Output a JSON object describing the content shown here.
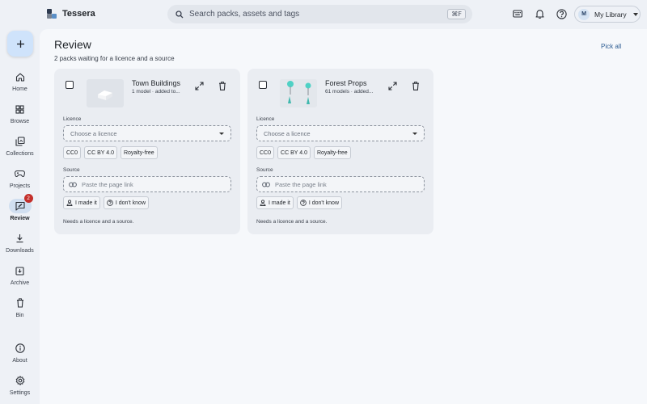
{
  "app": {
    "name": "Tessera"
  },
  "search": {
    "placeholder": "Search packs, assets and tags",
    "shortcut": "⌘F"
  },
  "topbar": {
    "icons": [
      "keyboard-icon",
      "bell-icon",
      "help-icon"
    ],
    "library": {
      "avatar": "M",
      "label": "My Library"
    }
  },
  "sidebar": {
    "new_button_icon": "plus-icon",
    "items": [
      {
        "label": "Home",
        "icon": "home-icon"
      },
      {
        "label": "Browse",
        "icon": "grid-icon"
      },
      {
        "label": "Collections",
        "icon": "collections-icon"
      },
      {
        "label": "Projects",
        "icon": "gamepad-icon"
      },
      {
        "label": "Review",
        "icon": "review-icon",
        "badge": "2",
        "active": true
      },
      {
        "label": "Downloads",
        "icon": "download-icon"
      },
      {
        "label": "Archive",
        "icon": "archive-icon"
      },
      {
        "label": "Bin",
        "icon": "trash-icon"
      },
      {
        "label": "About",
        "icon": "info-icon"
      },
      {
        "label": "Settings",
        "icon": "gear-icon"
      }
    ]
  },
  "page": {
    "title": "Review",
    "subtitle": "2 packs waiting for a licence and a source",
    "pick_all": "Pick all"
  },
  "cards": [
    {
      "title": "Town Buildings",
      "meta": "1 model · added to...",
      "licence_label": "Licence",
      "licence_placeholder": "Choose a licence",
      "licence_options": [
        "CC0",
        "CC BY 4.0",
        "Royalty-free"
      ],
      "source_label": "Source",
      "source_placeholder": "Paste the page link",
      "source_options": [
        "I made it",
        "I don't know"
      ],
      "note": "Needs a licence and a source."
    },
    {
      "title": "Forest Props",
      "meta": "61 models · added...",
      "licence_label": "Licence",
      "licence_placeholder": "Choose a licence",
      "licence_options": [
        "CC0",
        "CC BY 4.0",
        "Royalty-free"
      ],
      "source_label": "Source",
      "source_placeholder": "Paste the page link",
      "source_options": [
        "I made it",
        "I don't know"
      ],
      "note": "Needs a licence and a source."
    }
  ],
  "colors": {
    "accent": "#2f5e93",
    "badge": "#c4302b",
    "fab": "#cfe3fb",
    "active_nav": "#d1dff0"
  }
}
